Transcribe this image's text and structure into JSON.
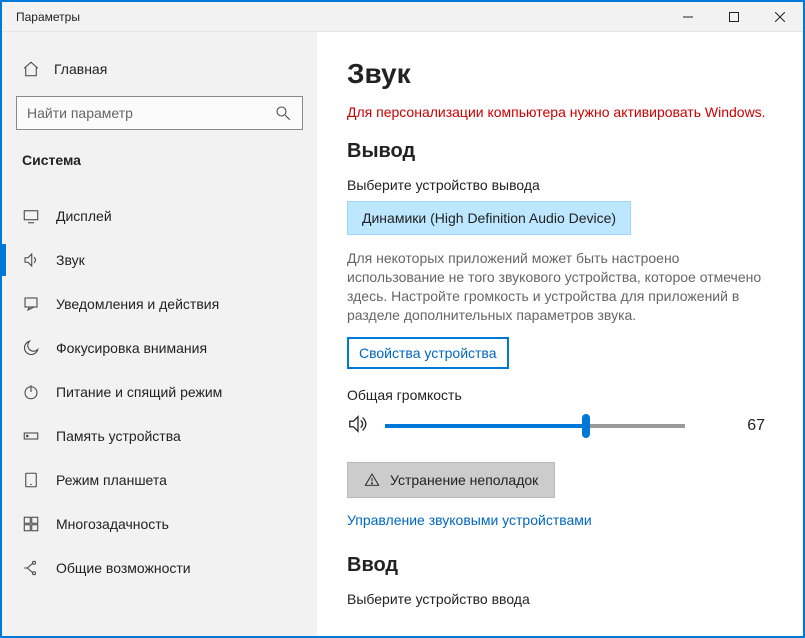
{
  "window": {
    "title": "Параметры"
  },
  "sidebar": {
    "home": "Главная",
    "search_placeholder": "Найти параметр",
    "section": "Система",
    "items": [
      {
        "label": "Дисплей"
      },
      {
        "label": "Звук"
      },
      {
        "label": "Уведомления и действия"
      },
      {
        "label": "Фокусировка внимания"
      },
      {
        "label": "Питание и спящий режим"
      },
      {
        "label": "Память устройства"
      },
      {
        "label": "Режим планшета"
      },
      {
        "label": "Многозадачность"
      },
      {
        "label": "Общие возможности"
      }
    ]
  },
  "main": {
    "title": "Звук",
    "warning": "Для персонализации компьютера нужно активировать Windows.",
    "output_heading": "Вывод",
    "output_device_label": "Выберите устройство вывода",
    "output_device_value": "Динамики (High Definition Audio Device)",
    "output_desc": "Для некоторых приложений может быть настроено использование не того звукового устройства, которое отмечено здесь. Настройте громкость и устройства для приложений в разделе дополнительных параметров звука.",
    "device_props_link": "Свойства устройства",
    "volume_label": "Общая громкость",
    "volume_value": "67",
    "troubleshoot": "Устранение неполадок",
    "manage_devices_link": "Управление звуковыми устройствами",
    "input_heading": "Ввод",
    "input_device_label": "Выберите устройство ввода"
  }
}
